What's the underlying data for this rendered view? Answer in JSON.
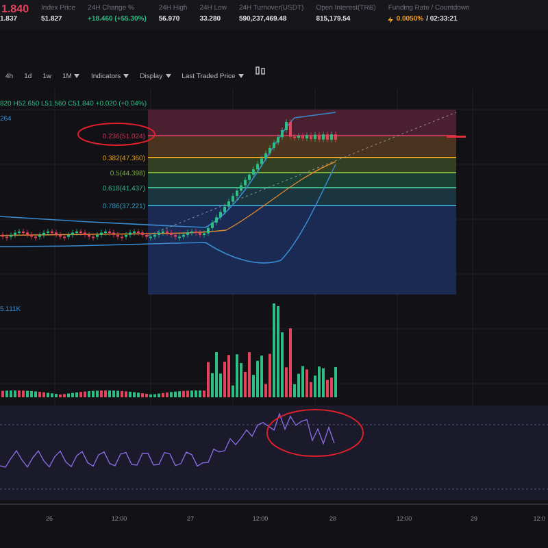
{
  "ticker": {
    "price": "1.840",
    "mark_price": "1.837",
    "color": "#e2445c"
  },
  "stats": [
    {
      "label": "Index Price",
      "value": "51.827",
      "color": "#e6e6ea"
    },
    {
      "label": "24H Change %",
      "value": "+18.460 (+55.30%)",
      "color": "#2ebd85"
    },
    {
      "label": "24H High",
      "value": "56.970",
      "color": "#e6e6ea"
    },
    {
      "label": "24H Low",
      "value": "33.280",
      "color": "#e6e6ea"
    },
    {
      "label": "24H Turnover(USDT)",
      "value": "590,237,469.48",
      "color": "#e6e6ea"
    },
    {
      "label": "Open Interest(TRB)",
      "value": "815,179.54",
      "color": "#e6e6ea"
    }
  ],
  "funding": {
    "label": "Funding Rate / Countdown",
    "rate": "0.0050%",
    "countdown": "/ 02:33:21"
  },
  "toolbar": [
    {
      "label": "4h",
      "dropdown": false
    },
    {
      "label": "1d",
      "dropdown": false
    },
    {
      "label": "1w",
      "dropdown": false
    },
    {
      "label": "1M",
      "dropdown": true
    },
    {
      "label": "Indicators",
      "dropdown": true
    },
    {
      "label": "Display",
      "dropdown": true
    },
    {
      "label": "Last Traded Price",
      "dropdown": true
    }
  ],
  "ohlc": "820 H52.650 L51.560 C51.840 +0.020 (+0.04%)",
  "indicator_value": "264",
  "fib_levels": [
    {
      "label": "0.236(51.024)",
      "color": "#c0395a"
    },
    {
      "label": "0.382(47.360)",
      "color": "#e0a020"
    },
    {
      "label": "0.5(44.398)",
      "color": "#7bb040"
    },
    {
      "label": "0.618(41.437)",
      "color": "#3fb58a"
    },
    {
      "label": "0.786(37.221)",
      "color": "#3a9bbf"
    }
  ],
  "volume_value": "5.111K",
  "time_axis": [
    "26",
    "12:00",
    "27",
    "12:00",
    "28",
    "12:00",
    "29",
    "12:0"
  ]
}
